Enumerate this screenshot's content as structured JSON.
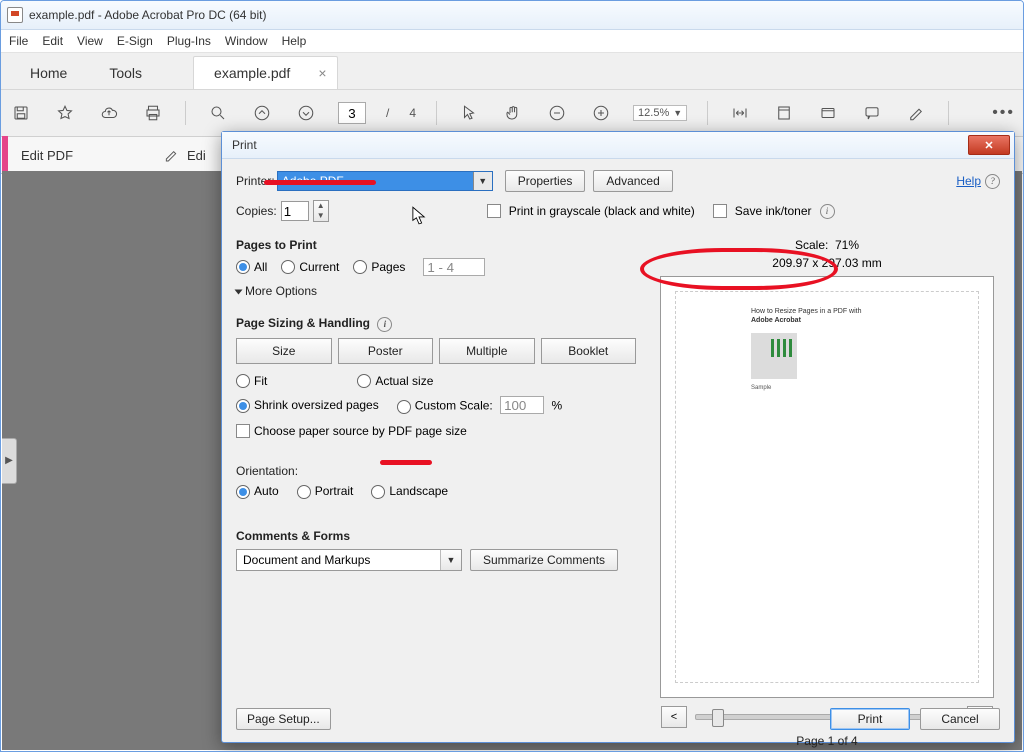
{
  "title": "example.pdf - Adobe Acrobat Pro DC (64 bit)",
  "menubar": [
    "File",
    "Edit",
    "View",
    "E-Sign",
    "Plug-Ins",
    "Window",
    "Help"
  ],
  "tabs": {
    "home": "Home",
    "tools": "Tools",
    "doc": "example.pdf"
  },
  "toolbar": {
    "page_current": "3",
    "page_sep": "/",
    "page_total": "4",
    "zoom": "12.5%"
  },
  "subbar": {
    "edit": "Edit PDF",
    "edit2": "Edi"
  },
  "dialog": {
    "title": "Print",
    "help": "Help",
    "printer_label": "Printer:",
    "printer_value": "Adobe PDF",
    "properties": "Properties",
    "advanced": "Advanced",
    "copies_label": "Copies:",
    "copies_value": "1",
    "grayscale": "Print in grayscale (black and white)",
    "saveink": "Save ink/toner",
    "pages_to_print": "Pages to Print",
    "all": "All",
    "current": "Current",
    "pages": "Pages",
    "pages_value": "1 - 4",
    "more_options": "More Options",
    "sizing": "Page Sizing & Handling",
    "size": "Size",
    "poster": "Poster",
    "multiple": "Multiple",
    "booklet": "Booklet",
    "fit": "Fit",
    "actual": "Actual size",
    "shrink": "Shrink oversized pages",
    "custom": "Custom Scale:",
    "custom_val": "100",
    "pct": "%",
    "choose_source": "Choose paper source by PDF page size",
    "orientation": "Orientation:",
    "auto": "Auto",
    "portrait": "Portrait",
    "landscape": "Landscape",
    "comments": "Comments & Forms",
    "comments_val": "Document and Markups",
    "summarize": "Summarize Comments",
    "scale_label": "Scale:",
    "scale_val": "71%",
    "dims": "209.97 x 297.03 mm",
    "preview_hdr1": "How to Resize Pages in a PDF with",
    "preview_hdr2": "Adobe Acrobat",
    "preview_cap": "Sample",
    "prev": "<",
    "next": ">",
    "page_of": "Page 1 of 4",
    "page_setup": "Page Setup...",
    "print": "Print",
    "cancel": "Cancel"
  }
}
